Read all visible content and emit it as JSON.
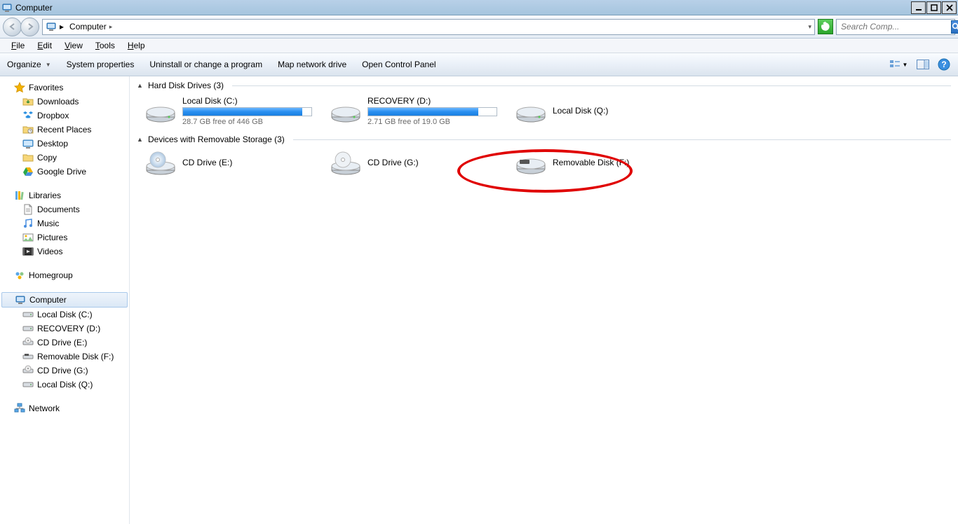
{
  "window": {
    "title": "Computer"
  },
  "address": {
    "crumb": "Computer"
  },
  "search": {
    "placeholder": "Search Comp..."
  },
  "menu": {
    "file": "File",
    "edit": "Edit",
    "view": "View",
    "tools": "Tools",
    "help": "Help"
  },
  "cmd": {
    "organize": "Organize",
    "sysprops": "System properties",
    "uninstall": "Uninstall or change a program",
    "mapnet": "Map network drive",
    "openctrl": "Open Control Panel"
  },
  "nav": {
    "favorites": {
      "label": "Favorites",
      "items": [
        "Downloads",
        "Dropbox",
        "Recent Places",
        "Desktop",
        "Copy",
        "Google Drive"
      ]
    },
    "libraries": {
      "label": "Libraries",
      "items": [
        "Documents",
        "Music",
        "Pictures",
        "Videos"
      ]
    },
    "homegroup": {
      "label": "Homegroup"
    },
    "computer": {
      "label": "Computer",
      "items": [
        "Local Disk (C:)",
        "RECOVERY (D:)",
        "CD Drive (E:)",
        "Removable Disk (F:)",
        "CD Drive (G:)",
        "Local Disk (Q:)"
      ]
    },
    "network": {
      "label": "Network"
    }
  },
  "sections": {
    "hdd": {
      "label": "Hard Disk Drives (3)"
    },
    "removable": {
      "label": "Devices with Removable Storage (3)"
    }
  },
  "drives": {
    "c": {
      "name": "Local Disk (C:)",
      "free": "28.7 GB free of 446 GB",
      "fillPct": 93
    },
    "d": {
      "name": "RECOVERY (D:)",
      "free": "2.71 GB free of 19.0 GB",
      "fillPct": 86
    },
    "q": {
      "name": "Local Disk (Q:)"
    },
    "e": {
      "name": "CD Drive (E:)"
    },
    "g": {
      "name": "CD Drive (G:)"
    },
    "f": {
      "name": "Removable Disk (F:)"
    }
  }
}
